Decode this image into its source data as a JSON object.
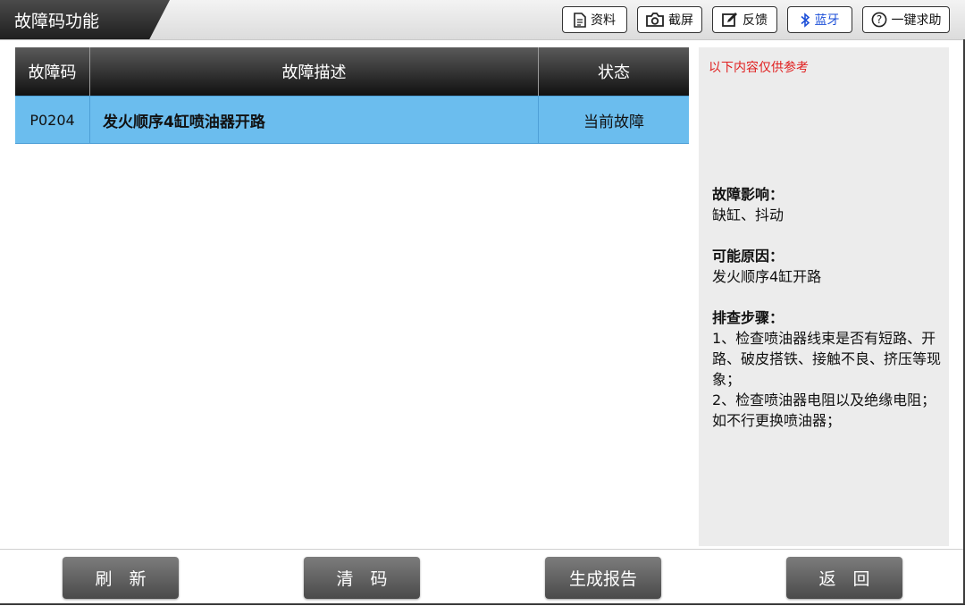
{
  "header": {
    "title": "故障码功能",
    "buttons": [
      {
        "label": "资料",
        "icon": "document-icon"
      },
      {
        "label": "截屏",
        "icon": "camera-icon"
      },
      {
        "label": "反馈",
        "icon": "edit-icon"
      },
      {
        "label": "蓝牙",
        "icon": "bluetooth-icon"
      },
      {
        "label": "一键求助",
        "icon": "help-icon"
      }
    ]
  },
  "table": {
    "headers": {
      "code": "故障码",
      "description": "故障描述",
      "status": "状态"
    },
    "rows": [
      {
        "code": "P0204",
        "description": "发火顺序4缸喷油器开路",
        "status": "当前故障"
      }
    ]
  },
  "panel": {
    "note": "以下内容仅供参考",
    "impact_title": "故障影响：",
    "impact_text": "缺缸、抖动",
    "cause_title": "可能原因：",
    "cause_text": "发火顺序4缸开路",
    "steps_title": "排查步骤：",
    "steps_text_1": "1、检查喷油器线束是否有短路、开路、破皮搭铁、接触不良、挤压等现象；",
    "steps_text_2": "2、检查喷油器电阻以及绝缘电阻；如不行更换喷油器；"
  },
  "footer": {
    "refresh": "刷　新",
    "clear": "清　码",
    "report": "生成报告",
    "back": "返　回"
  },
  "colors": {
    "selected_row": "#6bbdee",
    "note_red": "#e02020",
    "bluetooth_blue": "#1c4fd8"
  }
}
